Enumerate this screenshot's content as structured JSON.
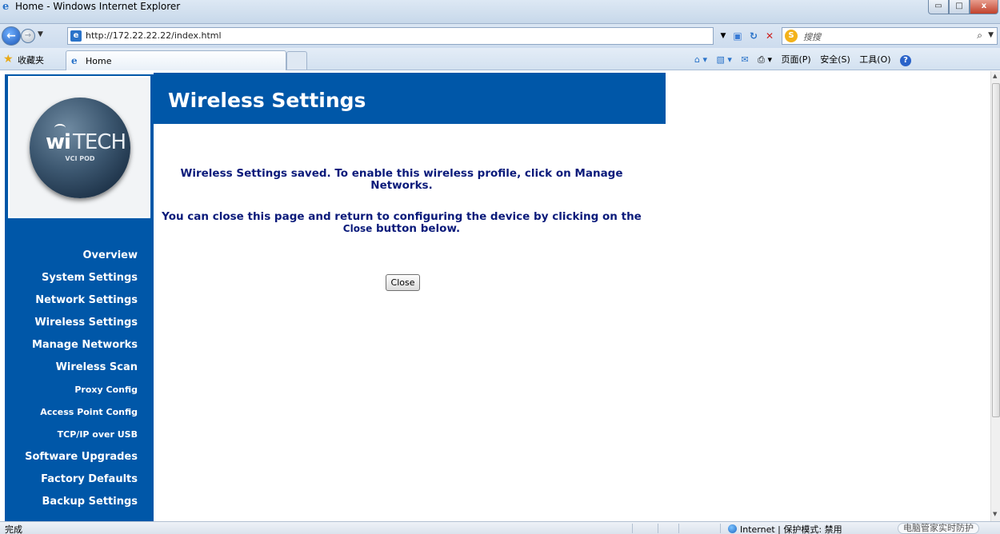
{
  "window": {
    "title": "Home - Windows Internet Explorer",
    "min_glyph": "▭",
    "max_glyph": "□",
    "close_glyph": "x"
  },
  "address": {
    "url": "http://172.22.22.22/index.html",
    "search_placeholder": "搜搜"
  },
  "favorites": {
    "label": "收藏夹"
  },
  "tabs": [
    {
      "label": "Home"
    }
  ],
  "command_bar": {
    "page": "页面(P)",
    "safety": "安全(S)",
    "tools": "工具(O)"
  },
  "logo": {
    "brand_bold": "wi",
    "brand_light": "TECH",
    "subtitle": "VCI POD"
  },
  "sidebar": {
    "items": [
      {
        "label": "Overview"
      },
      {
        "label": "System Settings"
      },
      {
        "label": "Network Settings"
      },
      {
        "label": "Wireless Settings"
      },
      {
        "label": "Manage Networks"
      },
      {
        "label": "Wireless Scan"
      },
      {
        "label": "Proxy Config"
      },
      {
        "label": "Access Point Config"
      },
      {
        "label": "TCP/IP over USB"
      },
      {
        "label": "Software Upgrades"
      },
      {
        "label": "Factory Defaults"
      },
      {
        "label": "Backup Settings"
      }
    ]
  },
  "main": {
    "title": "Wireless Settings",
    "message1": "Wireless Settings saved. To enable this wireless profile, click on Manage Networks.",
    "message2_before": "You can close this page and return to configuring the device by clicking on the",
    "message2_close_word": "Close",
    "message2_after": "button below.",
    "close_button": "Close"
  },
  "status": {
    "left": "完成",
    "zone": "Internet | 保护模式: 禁用",
    "helper": "电脑管家实时防护"
  },
  "colors": {
    "brand_blue": "#0057a8",
    "message_text": "#0a1a7a"
  }
}
